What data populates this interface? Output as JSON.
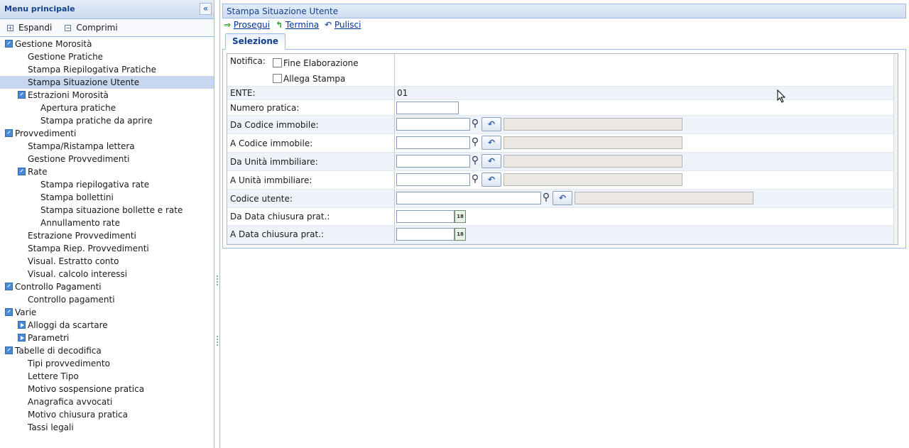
{
  "menu": {
    "title": "Menu principale",
    "collapse_icon": "double-chevron-left-icon",
    "toolbar": {
      "expand_label": "Espandi",
      "collapse_label": "Comprimi"
    },
    "items": [
      {
        "label": "Gestione Morosità",
        "level": 0,
        "toggle": "open"
      },
      {
        "label": "Gestione Pratiche",
        "level": 1
      },
      {
        "label": "Stampa Riepilogativa Pratiche",
        "level": 1
      },
      {
        "label": "Stampa Situazione Utente",
        "level": 1,
        "selected": true
      },
      {
        "label": "Estrazioni Morosità",
        "level": 1,
        "toggle": "open"
      },
      {
        "label": "Apertura pratiche",
        "level": 2
      },
      {
        "label": "Stampa pratiche da aprire",
        "level": 2
      },
      {
        "label": "Provvedimenti",
        "level": 0,
        "toggle": "open"
      },
      {
        "label": "Stampa/Ristampa lettera",
        "level": 1
      },
      {
        "label": "Gestione Provvedimenti",
        "level": 1
      },
      {
        "label": "Rate",
        "level": 1,
        "toggle": "open"
      },
      {
        "label": "Stampa riepilogativa rate",
        "level": 2
      },
      {
        "label": "Stampa bollettini",
        "level": 2
      },
      {
        "label": "Stampa situazione bollette e rate",
        "level": 2
      },
      {
        "label": "Annullamento rate",
        "level": 2
      },
      {
        "label": "Estrazione Provvedimenti",
        "level": 1
      },
      {
        "label": "Stampa Riep. Provvedimenti",
        "level": 1
      },
      {
        "label": "Visual. Estratto conto",
        "level": 1
      },
      {
        "label": "Visual. calcolo interessi",
        "level": 1
      },
      {
        "label": "Controllo Pagamenti",
        "level": 0,
        "toggle": "open"
      },
      {
        "label": "Controllo pagamenti",
        "level": 1
      },
      {
        "label": "Varie",
        "level": 0,
        "toggle": "open"
      },
      {
        "label": "Alloggi da scartare",
        "level": 1,
        "toggle": "closed"
      },
      {
        "label": "Parametri",
        "level": 1,
        "toggle": "closed"
      },
      {
        "label": "Tabelle di decodifica",
        "level": 0,
        "toggle": "open"
      },
      {
        "label": "Tipi provvedimento",
        "level": 1
      },
      {
        "label": "Lettere Tipo",
        "level": 1
      },
      {
        "label": "Motivo sospensione pratica",
        "level": 1
      },
      {
        "label": "Anagrafica avvocati",
        "level": 1
      },
      {
        "label": "Motivo chiusura pratica",
        "level": 1
      },
      {
        "label": "Tassi legali",
        "level": 1
      }
    ]
  },
  "panel": {
    "title": "Stampa Situazione Utente",
    "actions": {
      "prosegui": "Prosegui",
      "termina": "Termina",
      "pulisci": "Pulisci"
    },
    "tab": "Selezione"
  },
  "form": {
    "notifica_label": "Notifica:",
    "fine_elaborazione": "Fine Elaborazione",
    "allega_stampa": "Allega Stampa",
    "ente_label": "ENTE:",
    "ente_value": "01",
    "numero_pratica": "Numero pratica:",
    "da_codice_immobile": "Da Codice immobile:",
    "a_codice_immobile": "A Codice immobile:",
    "da_unita": "Da Unità immbiliare:",
    "a_unita": "A Unità immbiliare:",
    "codice_utente": "Codice utente:",
    "da_data": "Da Data chiusura prat.:",
    "a_data": "A Data chiusura prat.:",
    "calendar_glyph": "18"
  },
  "colors": {
    "accent": "#15428b",
    "border": "#99bbe8",
    "selected": "#c7d7ef"
  }
}
